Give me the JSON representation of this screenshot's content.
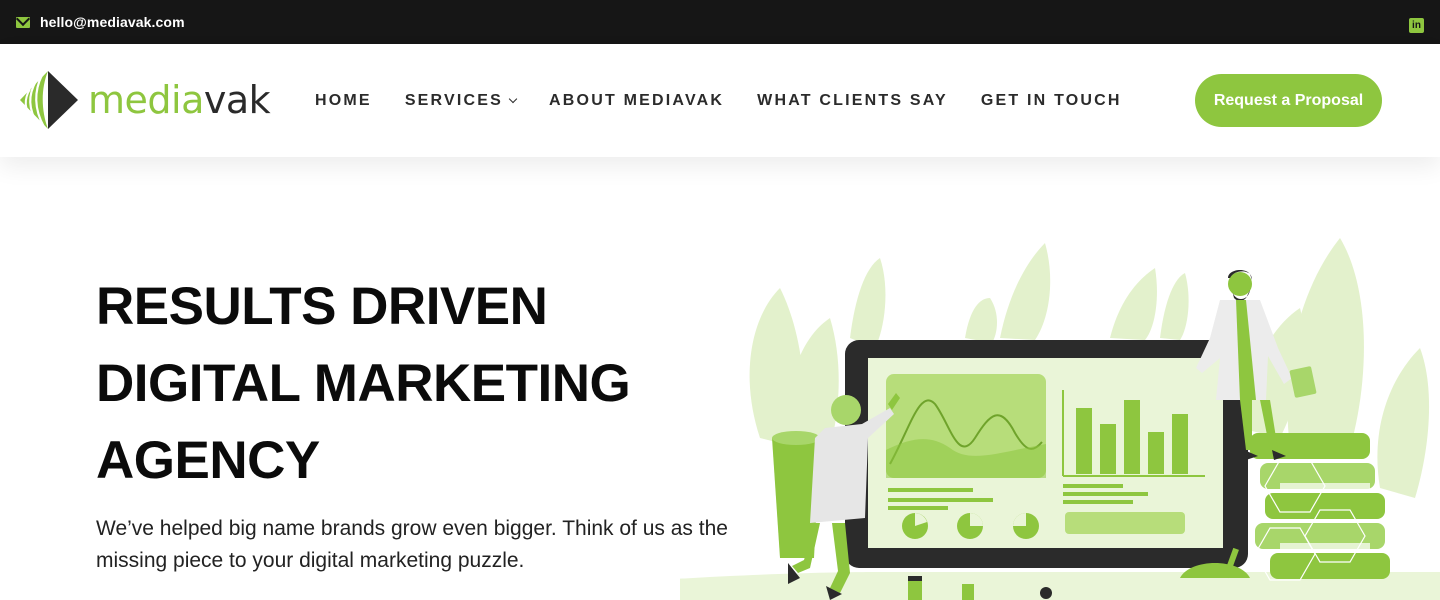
{
  "topbar": {
    "email": "hello@mediavak.com",
    "email_icon": "envelope-icon",
    "social_icon": "linkedin-icon",
    "social_label": "in"
  },
  "header": {
    "logo": {
      "part1": "media",
      "part2": "vak"
    },
    "nav": [
      {
        "label": "HOME"
      },
      {
        "label": "SERVICES",
        "has_dropdown": true
      },
      {
        "label": "ABOUT MEDIAVAK"
      },
      {
        "label": "WHAT CLIENTS SAY"
      },
      {
        "label": "GET IN TOUCH"
      }
    ],
    "cta_label": "Request a Proposal"
  },
  "hero": {
    "title_lines": [
      "RESULTS DRIVEN",
      "DIGITAL MARKETING",
      "AGENCY"
    ],
    "description": "We’ve helped big name brands grow even bigger. Think of us as the missing piece to your digital marketing puzzle."
  },
  "colors": {
    "accent": "#8ec63f",
    "topbar_bg": "#161616",
    "text_dark": "#0b0b0b"
  }
}
